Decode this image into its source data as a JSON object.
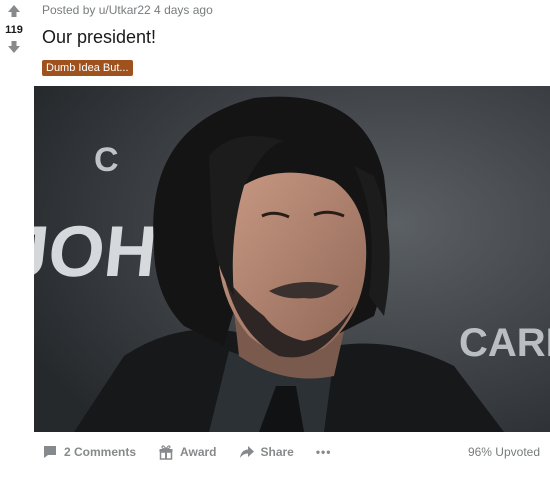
{
  "post": {
    "score": "119",
    "meta": "Posted by u/Utkar22 4 days ago",
    "title": "Our president!",
    "flair": "Dumb Idea But..."
  },
  "image": {
    "background_text_left": "C  JOHN",
    "background_text_right": "CARL"
  },
  "actions": {
    "comments_label": "2 Comments",
    "award_label": "Award",
    "share_label": "Share",
    "more_label": "•••",
    "upvoted_label": "96% Upvoted"
  },
  "colors": {
    "flair_bg": "#a0521e",
    "muted": "#878a8c"
  }
}
